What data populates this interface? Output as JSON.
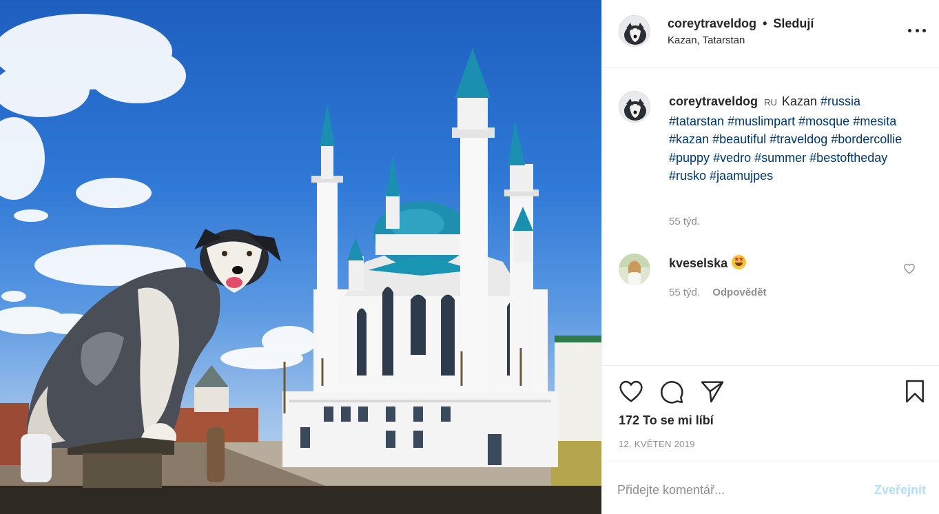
{
  "header": {
    "username": "coreytraveldog",
    "follow_status": "Sledují",
    "separator": "•",
    "location": "Kazan, Tatarstan"
  },
  "caption": {
    "username": "coreytraveldog",
    "flag": "RU",
    "text": "Kazan",
    "hashtags": [
      "#russia",
      "#tatarstan",
      "#muslimpart",
      "#mosque",
      "#mesita",
      "#kazan",
      "#beautiful",
      "#traveldog",
      "#bordercollie",
      "#puppy",
      "#vedro",
      "#summer",
      "#bestoftheday",
      "#rusko",
      "#jaamujpes"
    ],
    "time": "55 týd."
  },
  "comment": {
    "username": "kveselska",
    "emoji": "star-struck-emoji",
    "time": "55 týd.",
    "reply_label": "Odpovědět"
  },
  "actions": {
    "likes": "172 To se mi líbí",
    "date": "12. KVĚTEN 2019"
  },
  "add_comment": {
    "placeholder": "Přidejte komentář...",
    "post_label": "Zveřejnit"
  },
  "colors": {
    "hashtag": "#00376b",
    "post_button_disabled": "#b2dffc",
    "secondary_text": "#8e8e8e",
    "mosque_dome": "#1f8fb0"
  }
}
